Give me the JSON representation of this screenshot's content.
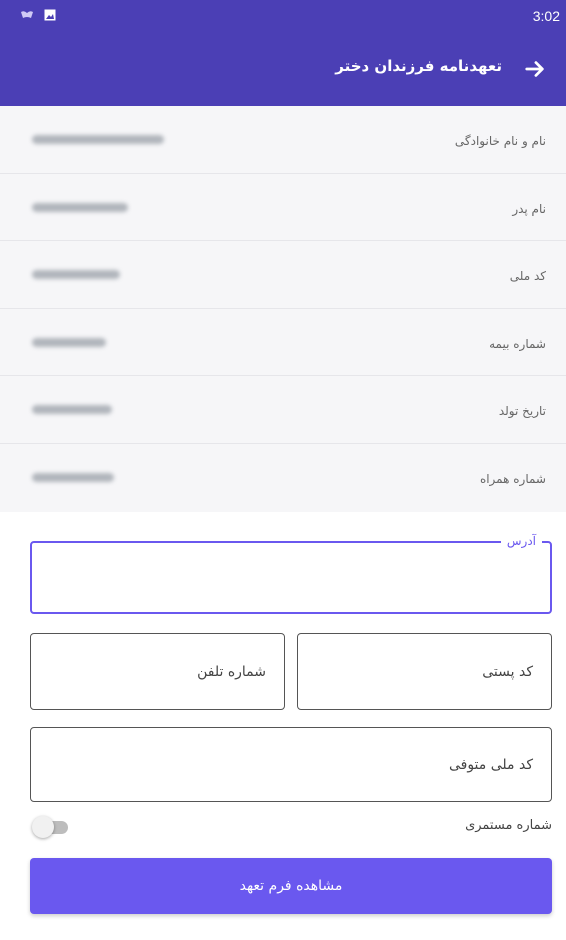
{
  "status_bar": {
    "time": "3:02",
    "icons": [
      "notification-icon",
      "image-icon"
    ]
  },
  "app_bar": {
    "title": "تعهدنامه فرزندان دختر",
    "back_icon": "arrow-right-icon"
  },
  "info_rows": [
    {
      "label": "نام و نام خانوادگی"
    },
    {
      "label": "نام پدر"
    },
    {
      "label": "کد ملی"
    },
    {
      "label": "شماره بیمه"
    },
    {
      "label": "تاریخ تولد"
    },
    {
      "label": "شماره همراه"
    }
  ],
  "form": {
    "address_label": "آدرس",
    "postal_code_placeholder": "کد پستی",
    "phone_placeholder": "شماره تلفن",
    "deceased_national_code_placeholder": "کد ملی متوفی",
    "pension_number_label": "شماره مستمری",
    "pension_switch_on": false,
    "submit_label": "مشاهده فرم تعهد"
  },
  "colors": {
    "primary": "#4b3fb5",
    "accent": "#6a58ef"
  }
}
